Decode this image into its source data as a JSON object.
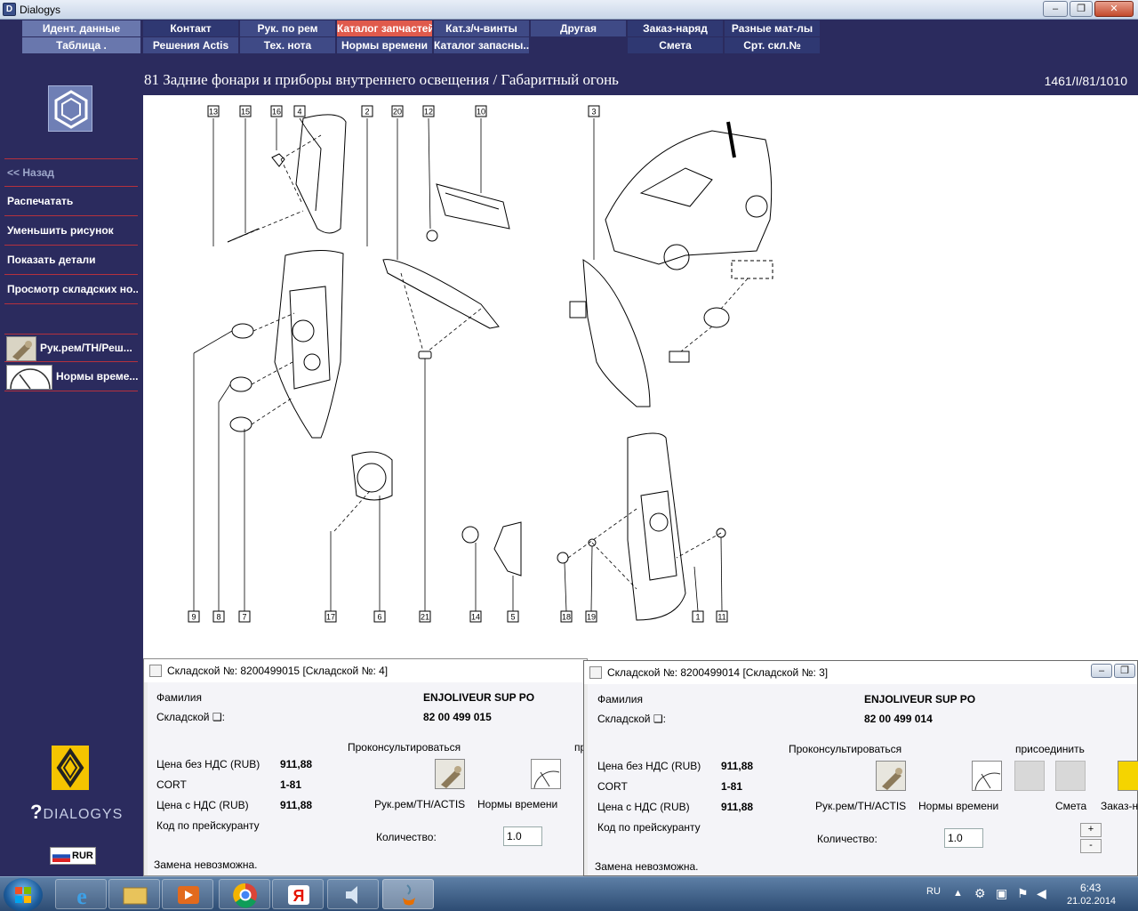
{
  "window": {
    "title": "Dialogys"
  },
  "menu": {
    "row1": [
      "Идент. данные",
      "Контакт",
      "Рук. по рем",
      "Каталог запчастей",
      "Кат.з/ч-винты",
      "Другая",
      "Заказ-наряд",
      "Разные мат-лы"
    ],
    "row2": [
      "Таблица .",
      "Решения Actis",
      "Тех. нота",
      "Нормы времени",
      "Каталог запасны...",
      "",
      "Смета",
      "Срт. скл.№"
    ]
  },
  "sidebar": {
    "nav": [
      "<< Назад",
      "Распечатать",
      "Уменьшить рисунок",
      "Показать детали",
      "Просмотр складских но..."
    ],
    "tools": [
      "Рук.рем/ТН/Реш...",
      "Нормы време..."
    ],
    "brand": "DIALOGYS",
    "currency": "RUR"
  },
  "header": {
    "title": "81 Задние фонари и приборы внутреннего освещения / Габаритный огонь",
    "ref": "1461/I/81/1010"
  },
  "diagram": {
    "callouts": [
      "13",
      "15",
      "16",
      "4",
      "2",
      "20",
      "12",
      "10",
      "3",
      "9",
      "8",
      "7",
      "17",
      "6",
      "21",
      "14",
      "5",
      "18",
      "19",
      "1",
      "11"
    ]
  },
  "dialog1": {
    "title": "Складской №: 8200499015 [Складской №: 4]",
    "label_family": "Фамилия",
    "family": "ENJOLIVEUR SUP PO",
    "label_part": "Складской ❑:",
    "part": "82 00 499 015",
    "consult": "Проконсультироваться",
    "attach": "пр",
    "label_price": "Цена без НДС (RUB)",
    "price": "911,88",
    "label_cort": "CORT",
    "cort": "1-81",
    "label_price_vat": "Цена с НДС (RUB)",
    "price_vat": "911,88",
    "label_code": "Код по прейскуранту",
    "tool1": "Рук.рем/TH/ACTIS",
    "tool2": "Нормы времени",
    "label_qty": "Количество:",
    "qty": "1.0",
    "replace": "Замена невозможна."
  },
  "dialog2": {
    "title": "Складской №: 8200499014 [Складской №: 3]",
    "label_family": "Фамилия",
    "family": "ENJOLIVEUR SUP PO",
    "label_part": "Складской ❑:",
    "part": "82 00 499 014",
    "consult": "Проконсультироваться",
    "attach": "присоединить",
    "label_price": "Цена без НДС (RUB)",
    "price": "911,88",
    "label_cort": "CORT",
    "cort": "1-81",
    "label_price_vat": "Цена с НДС (RUB)",
    "price_vat": "911,88",
    "label_code": "Код по прейскуранту",
    "tool1": "Рук.рем/TH/ACTIS",
    "tool2": "Нормы времени",
    "tool3": "Смета",
    "tool4": "Заказ-н",
    "label_qty": "Количество:",
    "qty": "1.0",
    "replace": "Замена невозможна."
  },
  "taskbar": {
    "lang": "RU",
    "time": "6:43",
    "date": "21.02.2014"
  }
}
